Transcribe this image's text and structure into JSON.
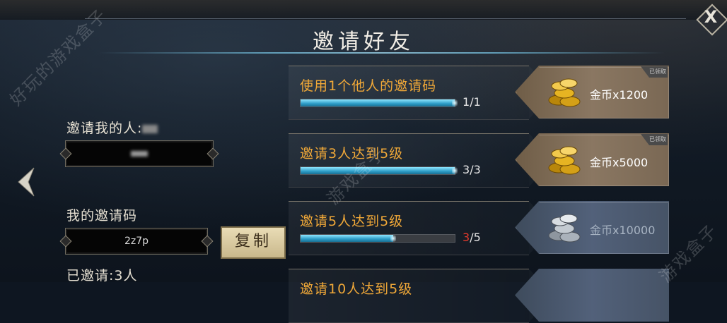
{
  "window": {
    "title": "邀请好友",
    "close_label": "X"
  },
  "left_panel": {
    "inviter_label": "邀请我的人:",
    "inviter_value": "",
    "my_code_label": "我的邀请码",
    "my_code_value": "2z7p",
    "copy_label": "复制",
    "invited_label": "已邀请:3人"
  },
  "tasks": [
    {
      "name": "使用1个他人的邀请码",
      "current": "1",
      "total": "/1",
      "progress": 1.0,
      "reward": "金币x1200",
      "reward_type": "gold",
      "claimed_label": "已领取"
    },
    {
      "name": "邀请3人达到5级",
      "current": "3",
      "total": "/3",
      "progress": 1.0,
      "reward": "金币x5000",
      "reward_type": "gold",
      "claimed_label": "已领取"
    },
    {
      "name": "邀请5人达到5级",
      "current": "3",
      "total": "/5",
      "progress": 0.6,
      "reward": "金币x10000",
      "reward_type": "silver"
    },
    {
      "name": "邀请10人达到5级",
      "reward_type": "silver"
    }
  ],
  "watermarks": [
    "好玩的游戏盒子",
    "游戏盒子",
    "游戏盒子"
  ],
  "colors": {
    "task_name": "#f0a838",
    "progress_fill": "#2c9bc6",
    "progress_short": "#e23a2c"
  }
}
